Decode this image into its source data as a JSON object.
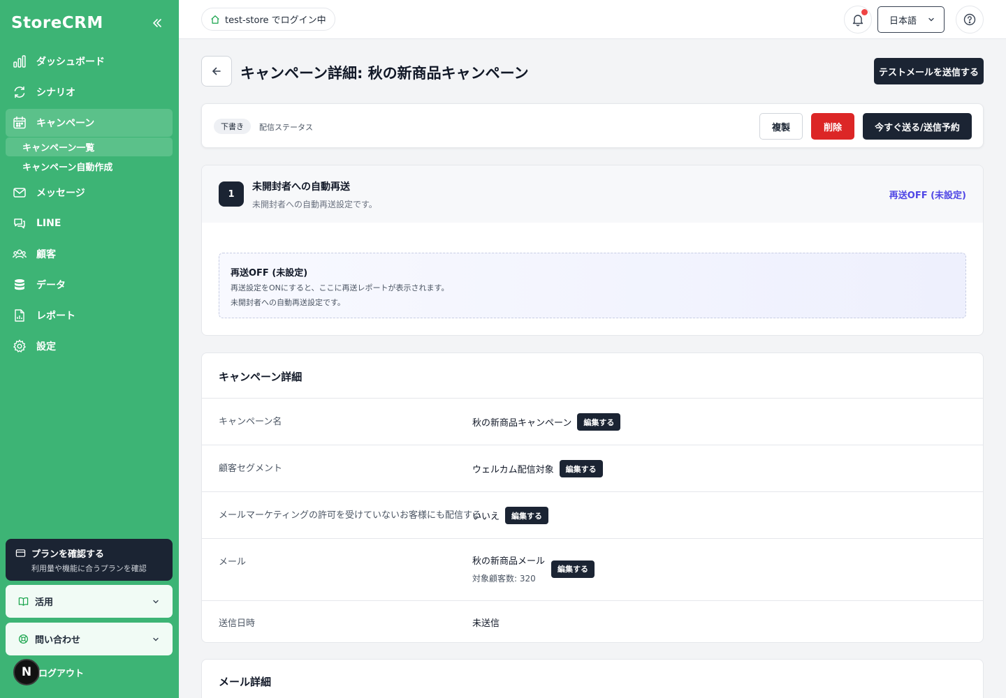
{
  "app": {
    "name": "StoreCRM"
  },
  "sidebar": {
    "items": [
      {
        "label": "ダッシュボード",
        "icon": "chart-bars-icon"
      },
      {
        "label": "シナリオ",
        "icon": "refresh-icon"
      },
      {
        "label": "キャンペーン",
        "icon": "calendar-icon",
        "active": true
      },
      {
        "label": "メッセージ",
        "icon": "mail-icon"
      },
      {
        "label": "LINE",
        "icon": "chat-icon"
      },
      {
        "label": "顧客",
        "icon": "users-icon"
      },
      {
        "label": "データ",
        "icon": "database-icon"
      },
      {
        "label": "レポート",
        "icon": "report-icon"
      },
      {
        "label": "設定",
        "icon": "gear-icon"
      }
    ],
    "subitems": [
      {
        "label": "キャンペーン一覧",
        "active": true
      },
      {
        "label": "キャンペーン自動作成"
      }
    ],
    "plan": {
      "title": "プランを確認する",
      "subtitle": "利用量や機能に合うプランを確認"
    },
    "accordions": [
      {
        "label": "活用"
      },
      {
        "label": "問い合わせ"
      }
    ],
    "avatar_letter": "N",
    "logout_label": "ログアウト"
  },
  "topbar": {
    "store_text": "test-store でログイン中",
    "language": "日本語"
  },
  "page": {
    "title": "キャンペーン詳細: 秋の新商品キャンペーン",
    "test_button": "テストメールを送信する"
  },
  "status": {
    "badge": "下書き",
    "label": "配信ステータス",
    "duplicate": "複製",
    "delete": "削除",
    "send": "今すぐ送る/送信予約"
  },
  "resend": {
    "step": "1",
    "title": "未開封者への自動再送",
    "description": "未開封者への自動再送設定です。",
    "status": "再送OFF (未設定)",
    "box_title": "再送OFF (未設定)",
    "box_line1": "再送設定をONにすると、ここに再送レポートが表示されます。",
    "box_line2": "未開封者への自動再送設定です。"
  },
  "details": {
    "title": "キャンペーン詳細",
    "edit_label": "編集する",
    "rows": [
      {
        "label": "キャンペーン名",
        "value": "秋の新商品キャンペーン"
      },
      {
        "label": "顧客セグメント",
        "value": "ウェルカム配信対象"
      },
      {
        "label": "メールマーケティングの許可を受けていないお客様にも配信する",
        "value": "いいえ"
      },
      {
        "label": "メール",
        "value": "秋の新商品メール",
        "sub": "対象顧客数: 320"
      },
      {
        "label": "送信日時",
        "value": "未送信"
      }
    ]
  },
  "mail_details": {
    "title": "メール詳細"
  },
  "colors": {
    "sidebar": "#3db475",
    "dark": "#1b2433",
    "danger": "#dc2626",
    "accent": "#4f46e5"
  }
}
